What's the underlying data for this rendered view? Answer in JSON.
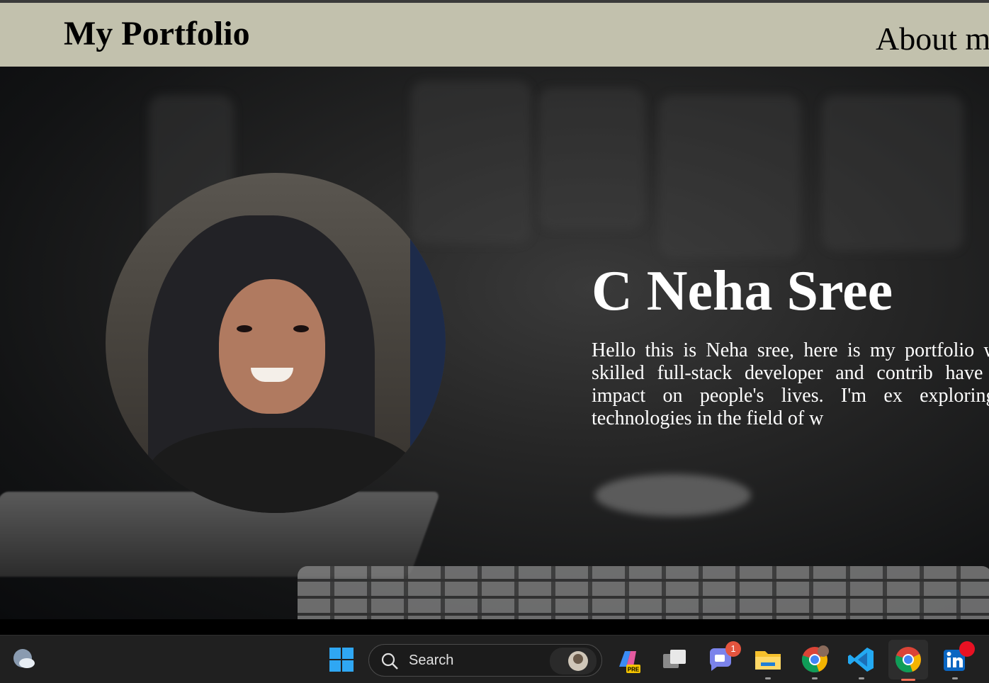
{
  "navbar": {
    "brand": "My Portfolio",
    "link_about": "About m"
  },
  "hero": {
    "name": "C Neha Sree",
    "bio": "Hello this is Neha sree, here is my portfolio w become a skilled full-stack developer and contrib have a spositive impact on people's lives. I'm ex exploring emerging technologies in the field of w"
  },
  "taskbar": {
    "search_label": "Search",
    "teams_badge": "1",
    "copilot_badge": "PRE",
    "items": [
      "weather-icon",
      "windows-start-icon",
      "search-icon",
      "copilot-icon",
      "task-view-icon",
      "teams-chat-icon",
      "file-explorer-icon",
      "chrome-icon",
      "vscode-icon",
      "chrome-active-icon",
      "linkedin-icon"
    ]
  },
  "colors": {
    "navbar_bg": "#c2c1ad",
    "taskbar_bg": "#202020",
    "hero_text": "#ffffff"
  }
}
